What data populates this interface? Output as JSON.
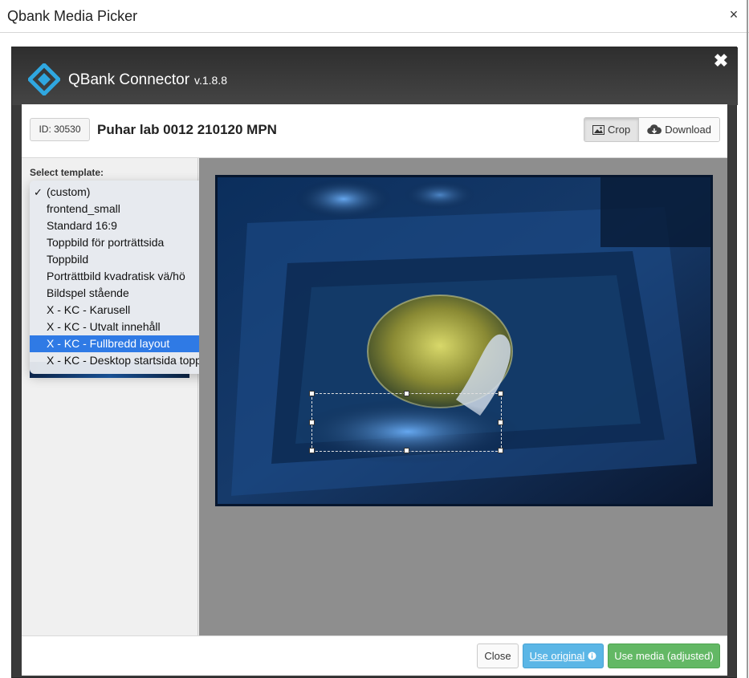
{
  "window": {
    "title": "Qbank Media Picker",
    "close_glyph": "×"
  },
  "connector": {
    "brand": "QBank Connector",
    "version": "v.1.8.8",
    "close_glyph": "✖",
    "logo_icon": "qbank-diamond-logo-icon"
  },
  "asset": {
    "id_label": "ID: 30530",
    "title": "Puhar lab 0012 210120 MPN"
  },
  "toolbar": {
    "crop_label": "Crop",
    "download_label": "Download",
    "active": "Crop"
  },
  "sidebar": {
    "select_label": "Select template:"
  },
  "templates": {
    "items": [
      {
        "label": "(custom)",
        "checked": true
      },
      {
        "label": "frontend_small"
      },
      {
        "label": "Standard 16:9"
      },
      {
        "label": "Toppbild för porträttsida"
      },
      {
        "label": "Toppbild"
      },
      {
        "label": "Porträttbild kvadratisk vä/hö"
      },
      {
        "label": "Bildspel stående"
      },
      {
        "label": "X - KC - Karusell"
      },
      {
        "label": "X - KC - Utvalt innehåll"
      },
      {
        "label": "X - KC - Fullbredd layout",
        "highlighted": true
      },
      {
        "label": "X - KC - Desktop startsida toppbild"
      }
    ],
    "check_glyph": "✓"
  },
  "footer": {
    "close_label": "Close",
    "use_original_label": "Use original",
    "use_media_label": "Use media (adjusted)"
  },
  "colors": {
    "highlight": "#2f7ae5",
    "use_original": "#5bb6e6",
    "use_media": "#63b865",
    "brand_logo": "#2fa7e0"
  }
}
